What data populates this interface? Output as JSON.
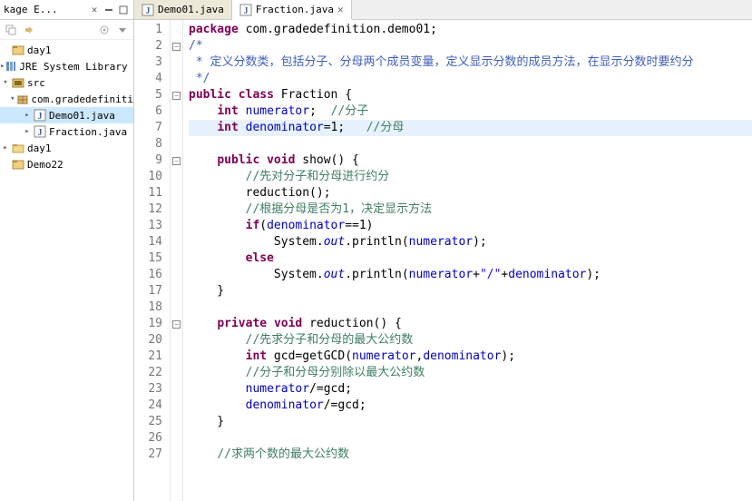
{
  "sidebar": {
    "title": "kage E...",
    "tree": [
      {
        "indent": 0,
        "expander": "",
        "icon": "project",
        "label": "day1"
      },
      {
        "indent": 0,
        "expander": "▸",
        "icon": "library",
        "label": "JRE System Library ["
      },
      {
        "indent": 0,
        "expander": "▾",
        "icon": "srcfolder",
        "label": "src"
      },
      {
        "indent": 12,
        "expander": "▾",
        "icon": "package",
        "label": "com.gradedefiniti"
      },
      {
        "indent": 24,
        "expander": "▸",
        "icon": "java",
        "label": "Demo01.java",
        "selected": true
      },
      {
        "indent": 24,
        "expander": "▸",
        "icon": "java",
        "label": "Fraction.java"
      },
      {
        "indent": 0,
        "expander": "▸",
        "icon": "folder",
        "label": "day1"
      },
      {
        "indent": 0,
        "expander": "",
        "icon": "project",
        "label": "Demo22"
      }
    ]
  },
  "tabs": [
    {
      "icon": "java",
      "label": "Demo01.java",
      "active": false
    },
    {
      "icon": "java",
      "label": "Fraction.java",
      "active": true,
      "close": true
    }
  ],
  "code": [
    {
      "n": 1,
      "fold": "",
      "tokens": [
        [
          "kw",
          "package"
        ],
        [
          "",
          " com.gradedefinition.demo01;"
        ]
      ]
    },
    {
      "n": 2,
      "fold": "-",
      "tokens": [
        [
          "doc",
          "/*"
        ]
      ]
    },
    {
      "n": 3,
      "fold": "",
      "tokens": [
        [
          "doc",
          " * 定义分数类，包括分子、分母两个成员变量，定义显示分数的成员方法，在显示分数时要约分"
        ]
      ]
    },
    {
      "n": 4,
      "fold": "",
      "tokens": [
        [
          "doc",
          " */"
        ]
      ]
    },
    {
      "n": 5,
      "fold": "-",
      "tokens": [
        [
          "kw",
          "public"
        ],
        [
          "",
          " "
        ],
        [
          "kw",
          "class"
        ],
        [
          "",
          " Fraction {"
        ]
      ]
    },
    {
      "n": 6,
      "fold": "",
      "tokens": [
        [
          "",
          "    "
        ],
        [
          "kw",
          "int"
        ],
        [
          "",
          " "
        ],
        [
          "fld",
          "numerator"
        ],
        [
          "",
          ";  "
        ],
        [
          "com",
          "//分子"
        ]
      ]
    },
    {
      "n": 7,
      "fold": "",
      "hl": true,
      "tokens": [
        [
          "",
          "    "
        ],
        [
          "kw",
          "int"
        ],
        [
          "",
          " "
        ],
        [
          "fld",
          "denominator"
        ],
        [
          "",
          "=1;   "
        ],
        [
          "com",
          "//分母"
        ]
      ]
    },
    {
      "n": 8,
      "fold": "",
      "tokens": [
        [
          "",
          ""
        ]
      ]
    },
    {
      "n": 9,
      "fold": "-",
      "tokens": [
        [
          "",
          "    "
        ],
        [
          "kw",
          "public"
        ],
        [
          "",
          " "
        ],
        [
          "kw",
          "void"
        ],
        [
          "",
          " show() {"
        ]
      ]
    },
    {
      "n": 10,
      "fold": "",
      "tokens": [
        [
          "",
          "        "
        ],
        [
          "com",
          "//先对分子和分母进行约分"
        ]
      ]
    },
    {
      "n": 11,
      "fold": "",
      "tokens": [
        [
          "",
          "        reduction();"
        ]
      ]
    },
    {
      "n": 12,
      "fold": "",
      "tokens": [
        [
          "",
          "        "
        ],
        [
          "com",
          "//根据分母是否为1，决定显示方法"
        ]
      ]
    },
    {
      "n": 13,
      "fold": "",
      "tokens": [
        [
          "",
          "        "
        ],
        [
          "kw",
          "if"
        ],
        [
          "",
          "("
        ],
        [
          "fld",
          "denominator"
        ],
        [
          "",
          "==1)"
        ]
      ]
    },
    {
      "n": 14,
      "fold": "",
      "tokens": [
        [
          "",
          "            System."
        ],
        [
          "sfld",
          "out"
        ],
        [
          "",
          ".println("
        ],
        [
          "fld",
          "numerator"
        ],
        [
          "",
          ");"
        ]
      ]
    },
    {
      "n": 15,
      "fold": "",
      "tokens": [
        [
          "",
          "        "
        ],
        [
          "kw",
          "else"
        ]
      ]
    },
    {
      "n": 16,
      "fold": "",
      "tokens": [
        [
          "",
          "            System."
        ],
        [
          "sfld",
          "out"
        ],
        [
          "",
          ".println("
        ],
        [
          "fld",
          "numerator"
        ],
        [
          "",
          "+"
        ],
        [
          "str",
          "\"/\""
        ],
        [
          "",
          "+"
        ],
        [
          "fld",
          "denominator"
        ],
        [
          "",
          ");"
        ]
      ]
    },
    {
      "n": 17,
      "fold": "",
      "tokens": [
        [
          "",
          "    }"
        ]
      ]
    },
    {
      "n": 18,
      "fold": "",
      "tokens": [
        [
          "",
          ""
        ]
      ]
    },
    {
      "n": 19,
      "fold": "-",
      "tokens": [
        [
          "",
          "    "
        ],
        [
          "kw",
          "private"
        ],
        [
          "",
          " "
        ],
        [
          "kw",
          "void"
        ],
        [
          "",
          " reduction() {"
        ]
      ]
    },
    {
      "n": 20,
      "fold": "",
      "tokens": [
        [
          "",
          "        "
        ],
        [
          "com",
          "//先求分子和分母的最大公约数"
        ]
      ]
    },
    {
      "n": 21,
      "fold": "",
      "tokens": [
        [
          "",
          "        "
        ],
        [
          "kw",
          "int"
        ],
        [
          "",
          " gcd=getGCD("
        ],
        [
          "fld",
          "numerator"
        ],
        [
          "",
          ","
        ],
        [
          "fld",
          "denominator"
        ],
        [
          "",
          ");"
        ]
      ]
    },
    {
      "n": 22,
      "fold": "",
      "tokens": [
        [
          "",
          "        "
        ],
        [
          "com",
          "//分子和分母分别除以最大公约数"
        ]
      ]
    },
    {
      "n": 23,
      "fold": "",
      "tokens": [
        [
          "",
          "        "
        ],
        [
          "fld",
          "numerator"
        ],
        [
          "",
          "/=gcd;"
        ]
      ]
    },
    {
      "n": 24,
      "fold": "",
      "tokens": [
        [
          "",
          "        "
        ],
        [
          "fld",
          "denominator"
        ],
        [
          "",
          "/=gcd;"
        ]
      ]
    },
    {
      "n": 25,
      "fold": "",
      "tokens": [
        [
          "",
          "    }"
        ]
      ]
    },
    {
      "n": 26,
      "fold": "",
      "tokens": [
        [
          "",
          ""
        ]
      ]
    },
    {
      "n": 27,
      "fold": "",
      "tokens": [
        [
          "",
          "    "
        ],
        [
          "com",
          "//求两个数的最大公约数"
        ]
      ]
    }
  ]
}
